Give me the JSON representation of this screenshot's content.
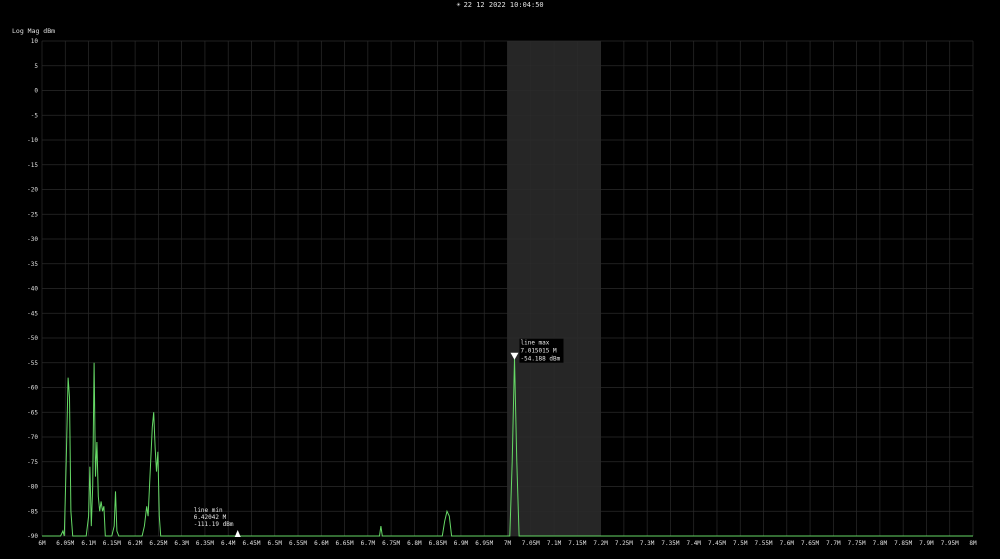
{
  "header": {
    "icon": "sun-icon",
    "datetime": "22 12 2022 10:04:50"
  },
  "chart_data": {
    "type": "line",
    "ylabel": "Log Mag dBm",
    "xlabel": "",
    "xlim": [
      6000000,
      8000000
    ],
    "ylim": [
      -90,
      10
    ],
    "x_ticks": [
      "6M",
      "6.05M",
      "6.1M",
      "6.15M",
      "6.2M",
      "6.25M",
      "6.3M",
      "6.35M",
      "6.4M",
      "6.45M",
      "6.5M",
      "6.55M",
      "6.6M",
      "6.65M",
      "6.7M",
      "6.75M",
      "6.8M",
      "6.85M",
      "6.9M",
      "6.95M",
      "7M",
      "7.05M",
      "7.1M",
      "7.15M",
      "7.2M",
      "7.25M",
      "7.3M",
      "7.35M",
      "7.4M",
      "7.45M",
      "7.5M",
      "7.55M",
      "7.6M",
      "7.65M",
      "7.7M",
      "7.75M",
      "7.8M",
      "7.85M",
      "7.9M",
      "7.95M",
      "8M"
    ],
    "y_ticks": [
      "10",
      "5",
      "0",
      "-5",
      "-10",
      "-15",
      "-20",
      "-25",
      "-30",
      "-35",
      "-40",
      "-45",
      "-50",
      "-55",
      "-60",
      "-65",
      "-70",
      "-75",
      "-80",
      "-85",
      "-90"
    ],
    "grid": true,
    "line_color": "#66d966",
    "band": {
      "from": 7000000,
      "to": 7200000,
      "color": "#262626"
    },
    "series": [
      {
        "points": [
          [
            6000000,
            -90
          ],
          [
            6040000,
            -90
          ],
          [
            6045000,
            -89
          ],
          [
            6048000,
            -90
          ],
          [
            6052000,
            -75
          ],
          [
            6056000,
            -58
          ],
          [
            6059000,
            -62
          ],
          [
            6062000,
            -85
          ],
          [
            6066000,
            -90
          ],
          [
            6095000,
            -90
          ],
          [
            6100000,
            -86
          ],
          [
            6103000,
            -76
          ],
          [
            6106000,
            -88
          ],
          [
            6109000,
            -80
          ],
          [
            6112000,
            -55
          ],
          [
            6115000,
            -78
          ],
          [
            6118000,
            -71
          ],
          [
            6121000,
            -82
          ],
          [
            6124000,
            -85
          ],
          [
            6127000,
            -83
          ],
          [
            6130000,
            -85
          ],
          [
            6133000,
            -84
          ],
          [
            6136000,
            -90
          ],
          [
            6150000,
            -90
          ],
          [
            6155000,
            -88
          ],
          [
            6158000,
            -81
          ],
          [
            6161000,
            -89
          ],
          [
            6165000,
            -90
          ],
          [
            6215000,
            -90
          ],
          [
            6220000,
            -88
          ],
          [
            6225000,
            -84
          ],
          [
            6228000,
            -86
          ],
          [
            6231000,
            -80
          ],
          [
            6234000,
            -74
          ],
          [
            6237000,
            -68
          ],
          [
            6240000,
            -65
          ],
          [
            6243000,
            -72
          ],
          [
            6246000,
            -77
          ],
          [
            6249000,
            -73
          ],
          [
            6252000,
            -86
          ],
          [
            6255000,
            -90
          ],
          [
            6420000,
            -90
          ],
          [
            6420420,
            -90
          ],
          [
            6725000,
            -90
          ],
          [
            6728000,
            -88
          ],
          [
            6731000,
            -90
          ],
          [
            6860000,
            -90
          ],
          [
            6865000,
            -87
          ],
          [
            6870000,
            -85
          ],
          [
            6875000,
            -86
          ],
          [
            6880000,
            -90
          ],
          [
            7005000,
            -90
          ],
          [
            7010000,
            -75
          ],
          [
            7015015,
            -54.188
          ],
          [
            7020000,
            -75
          ],
          [
            7025000,
            -90
          ],
          [
            8000000,
            -90
          ]
        ]
      }
    ],
    "markers": [
      {
        "label": "line max",
        "freq": "7.015015 M",
        "level": "-54.188 dBm",
        "x": 7015015,
        "y": -54.188,
        "direction": "down"
      },
      {
        "label": "line min",
        "freq": "6.42042 M",
        "level": "-111.19 dBm",
        "x": 6420420,
        "y": -90,
        "direction": "up"
      }
    ]
  }
}
